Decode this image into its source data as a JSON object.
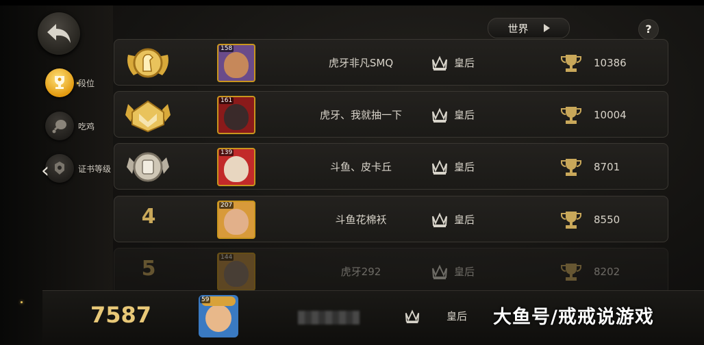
{
  "header": {
    "world_label": "世界",
    "help_label": "?"
  },
  "nav": {
    "items": [
      {
        "label": "段位",
        "icon": "trophy-icon",
        "active": true
      },
      {
        "label": "吃鸡",
        "icon": "chicken-leg-icon",
        "active": false
      },
      {
        "label": "证书等级",
        "icon": "certificate-icon",
        "active": false
      }
    ]
  },
  "rows": [
    {
      "rank": "1",
      "level": "158",
      "name": "虎牙非凡SMQ",
      "title": "皇后",
      "score": "10386"
    },
    {
      "rank": "2",
      "level": "161",
      "name": "虎牙、我就抽一下",
      "title": "皇后",
      "score": "10004"
    },
    {
      "rank": "3",
      "level": "139",
      "name": "斗鱼、皮卡丘",
      "title": "皇后",
      "score": "8701"
    },
    {
      "rank": "4",
      "level": "207",
      "name": "斗鱼花棉袄",
      "title": "皇后",
      "score": "8550"
    },
    {
      "rank": "5",
      "level": "144",
      "name": "虎牙292",
      "title": "皇后",
      "score": "8202"
    }
  ],
  "me": {
    "score": "7587",
    "level": "59",
    "title": "皇后"
  },
  "watermark": "大鱼号/戒戒说游戏",
  "colors": {
    "accent_gold": "#c9a85a",
    "panel": "#1f1d1a",
    "active_nav": "#e29a10"
  }
}
